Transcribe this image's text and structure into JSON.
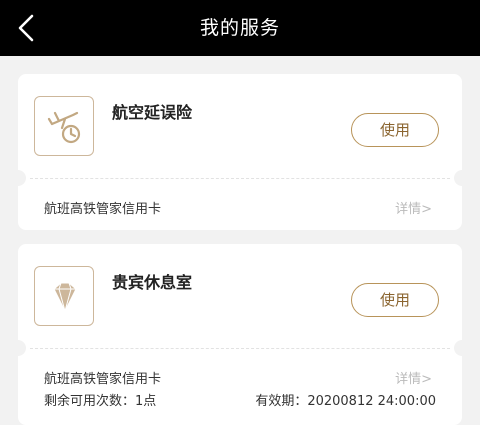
{
  "header": {
    "title": "我的服务"
  },
  "services": [
    {
      "name": "航空延误险",
      "button": "使用",
      "card_name": "航班高铁管家信用卡",
      "detail": "详情>"
    },
    {
      "name": "贵宾休息室",
      "button": "使用",
      "card_name": "航班高铁管家信用卡",
      "detail": "详情>",
      "remaining": "剩余可用次数：1点",
      "expiry": "有效期：20200812 24:00:00"
    }
  ],
  "colors": {
    "accent": "#b8945a",
    "header_bg": "#000000",
    "page_bg": "#f2f2f2"
  },
  "icons": [
    "back-arrow-icon",
    "flight-delay-icon",
    "diamond-icon"
  ]
}
